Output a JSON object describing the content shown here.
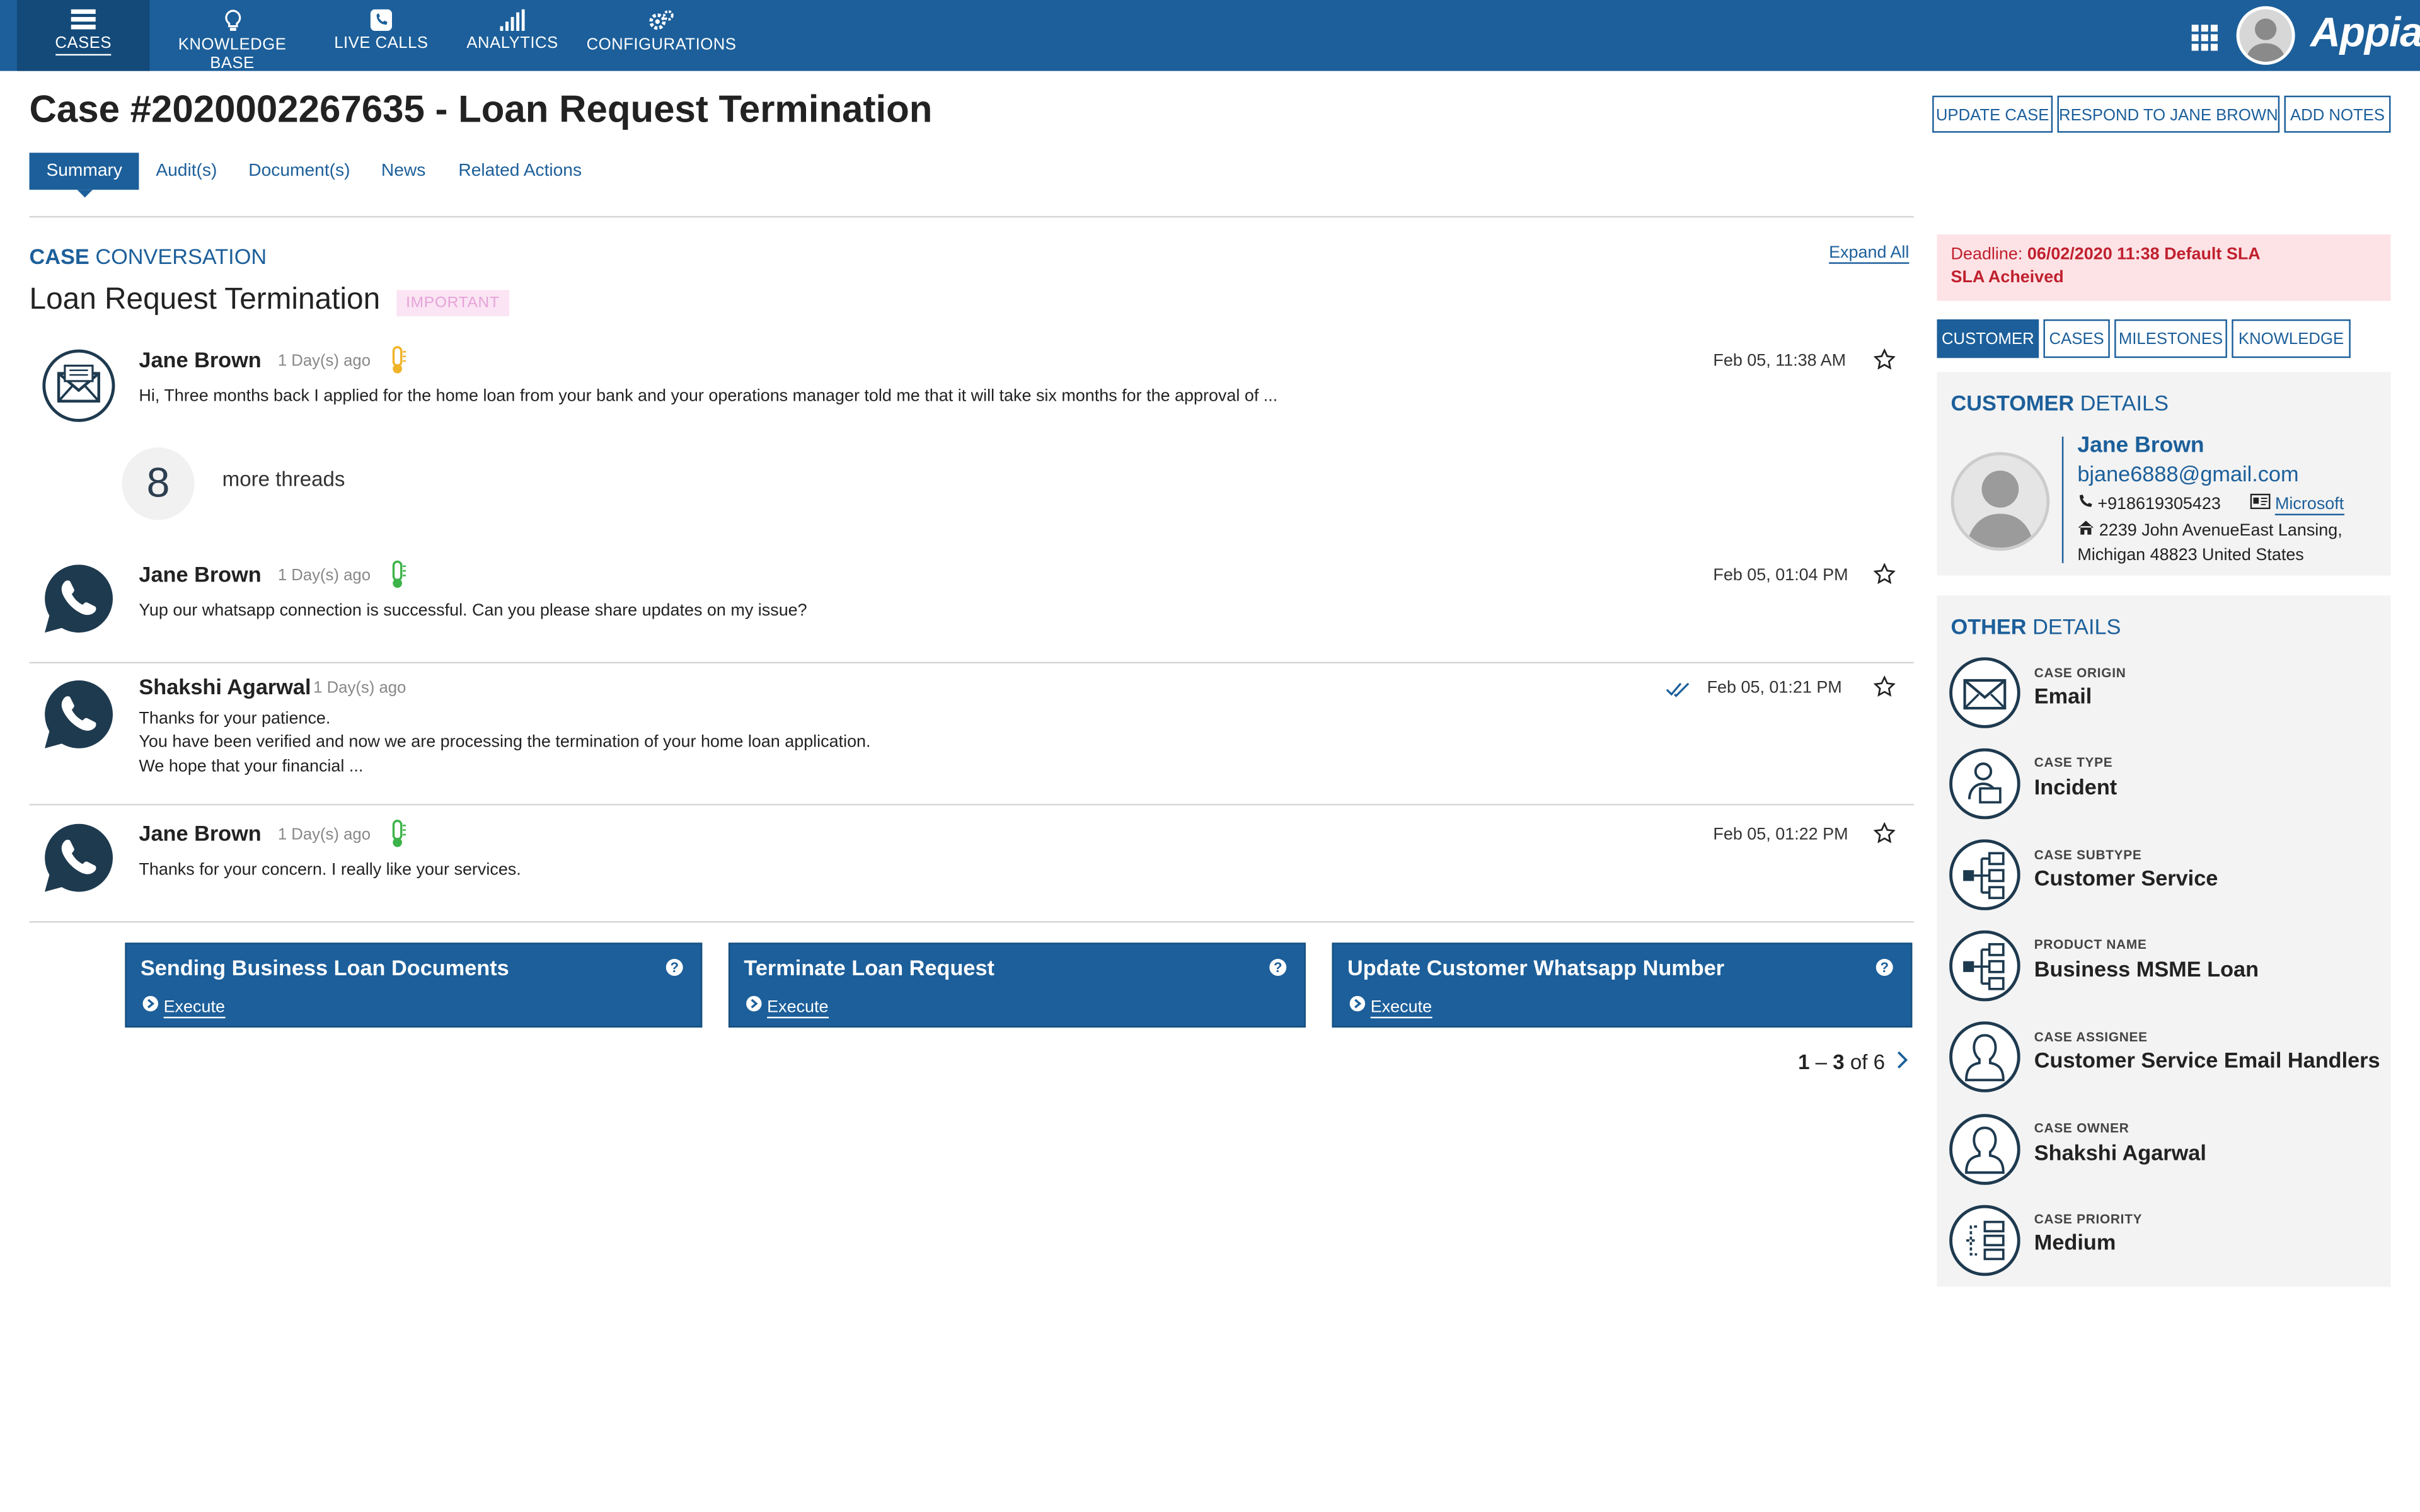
{
  "nav": {
    "items": [
      {
        "label": "CASES",
        "icon": "list-icon"
      },
      {
        "label": "KNOWLEDGE BASE",
        "icon": "lightbulb-icon"
      },
      {
        "label": "LIVE CALLS",
        "icon": "phone-icon"
      },
      {
        "label": "ANALYTICS",
        "icon": "signal-bars-icon"
      },
      {
        "label": "CONFIGURATIONS",
        "icon": "gears-icon"
      }
    ],
    "logo": "Appian"
  },
  "header": {
    "title": "Case #2020002267635 - Loan Request Termination",
    "buttons": [
      "UPDATE CASE",
      "RESPOND TO JANE BROWN",
      "ADD NOTES"
    ]
  },
  "tabs": [
    "Summary",
    "Audit(s)",
    "Document(s)",
    "News",
    "Related Actions"
  ],
  "conversation": {
    "label_bold": "CASE",
    "label_rest": "CONVERSATION",
    "expand_all": "Expand All",
    "title": "Loan Request Termination",
    "badge": "IMPORTANT",
    "more_threads_count": "8",
    "more_threads_label": "more threads",
    "messages": [
      {
        "sender": "Jane Brown",
        "ago": "1 Day(s) ago",
        "time": "Feb 05, 11:38 AM",
        "channel": "email-icon",
        "sentiment_color": "#f0b429",
        "lines": [
          "Hi, Three months back I applied for the home loan from your bank and your operations manager told me that it will take six months for the approval of ..."
        ]
      },
      {
        "sender": "Jane Brown",
        "ago": "1 Day(s) ago",
        "time": "Feb 05, 01:04 PM",
        "channel": "whatsapp-icon",
        "sentiment_color": "#3cb34a",
        "lines": [
          "Yup our whatsapp connection is successful. Can you please share updates on my issue?"
        ]
      },
      {
        "sender": "Shakshi Agarwal",
        "ago": "1 Day(s) ago",
        "time": "Feb 05, 01:21 PM",
        "channel": "whatsapp-icon",
        "lines": [
          "Thanks for your patience.",
          "You have been verified and now we are processing the termination of your home loan application.",
          "We hope that your financial ..."
        ]
      },
      {
        "sender": "Jane Brown",
        "ago": "1 Day(s) ago",
        "time": "Feb 05, 01:22 PM",
        "channel": "whatsapp-icon",
        "sentiment_color": "#3cb34a",
        "lines": [
          "Thanks for your concern. I really like your services."
        ]
      }
    ]
  },
  "actions": {
    "cards": [
      {
        "title": "Sending Business Loan Documents",
        "execute": "Execute"
      },
      {
        "title": "Terminate Loan Request",
        "execute": "Execute"
      },
      {
        "title": "Update Customer Whatsapp Number",
        "execute": "Execute"
      }
    ],
    "pager": {
      "range_start": "1",
      "range_end": "3",
      "of_label": "of 6"
    }
  },
  "deadline": {
    "label": "Deadline:",
    "value": "06/02/2020 11:38 Default SLA",
    "status": "SLA Acheived"
  },
  "right_tabs": [
    "CUSTOMER",
    "CASES",
    "MILESTONES",
    "KNOWLEDGE"
  ],
  "customer": {
    "title_bold": "CUSTOMER",
    "title_rest": "DETAILS",
    "name": "Jane Brown",
    "email": "bjane6888@gmail.com",
    "phone": "+918619305423",
    "company": "Microsoft",
    "address_line1": "2239  John AvenueEast Lansing,",
    "address_line2": "Michigan 48823 United States"
  },
  "other": {
    "title_bold": "OTHER",
    "title_rest": "DETAILS",
    "items": [
      {
        "label": "CASE ORIGIN",
        "value": "Email",
        "icon": "envelope-icon"
      },
      {
        "label": "CASE TYPE",
        "value": "Incident",
        "icon": "agent-icon"
      },
      {
        "label": "CASE SUBTYPE",
        "value": "Customer Service",
        "icon": "hierarchy-icon"
      },
      {
        "label": "PRODUCT NAME",
        "value": "Business MSME Loan",
        "icon": "hierarchy-icon"
      },
      {
        "label": "CASE ASSIGNEE",
        "value": "Customer Service Email Handlers",
        "icon": "person-icon"
      },
      {
        "label": "CASE OWNER",
        "value": "Shakshi Agarwal",
        "icon": "person-icon"
      },
      {
        "label": "CASE PRIORITY",
        "value": "Medium",
        "icon": "flow-icon"
      }
    ]
  },
  "colors": {
    "primary": "#1c5f9a",
    "deadline_bg": "#fde3e6",
    "deadline_text": "#c0202e",
    "badge_bg": "#fbe4f4"
  }
}
